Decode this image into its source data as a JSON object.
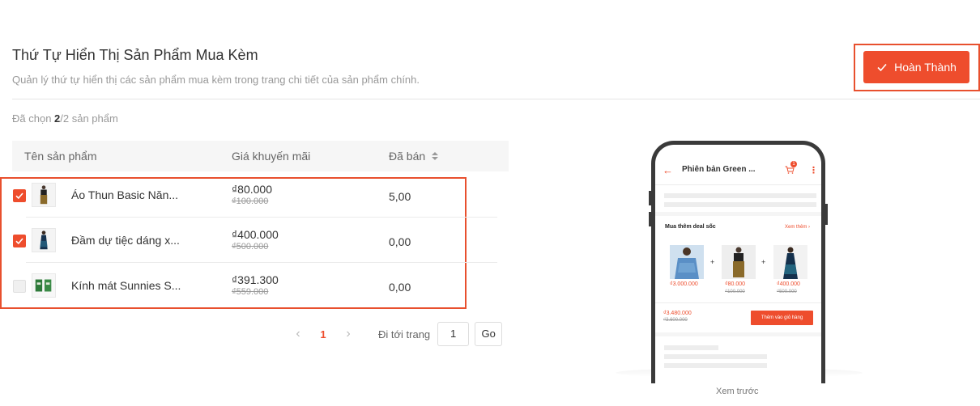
{
  "header": {
    "title": "Thứ Tự Hiển Thị Sản Phẩm Mua Kèm",
    "subtitle": "Quản lý thứ tự hiển thị các sản phẩm mua kèm trong trang chi tiết của sản phẩm chính.",
    "done_label": "Hoàn Thành"
  },
  "selection": {
    "prefix": "Đã chọn ",
    "selected": "2",
    "suffix": "/2 sản phẩm"
  },
  "table": {
    "columns": {
      "name": "Tên sản phẩm",
      "price": "Giá khuyến mãi",
      "sold": "Đã bán"
    },
    "rows": [
      {
        "checked": true,
        "name": "Áo Thun Basic Năn...",
        "price": "₫80.000",
        "original_price": "₫100.000",
        "sold": "5,00",
        "thumb": "pants-model"
      },
      {
        "checked": true,
        "name": "Đầm dự tiệc dáng x...",
        "price": "₫400.000",
        "original_price": "₫500.000",
        "sold": "0,00",
        "thumb": "dress-model"
      },
      {
        "checked": false,
        "name": "Kính mát Sunnies S...",
        "price": "₫391.300",
        "original_price": "₫559.000",
        "sold": "0,00",
        "thumb": "sunglasses-box"
      }
    ]
  },
  "pagination": {
    "current": "1",
    "goto_label": "Đi tới trang",
    "goto_value": "1",
    "go_label": "Go"
  },
  "preview": {
    "label": "Xem trước",
    "title": "Phiên bản Green ...",
    "cart_count": "1",
    "deal_title": "Mua thêm deal sốc",
    "see_more": "Xem thêm",
    "products": [
      {
        "price": "₫3.000.000",
        "original": ""
      },
      {
        "price": "₫80.000",
        "original": "₫100.000"
      },
      {
        "price": "₫400.000",
        "original": "₫500.000"
      }
    ],
    "total": "₫3.480.000",
    "total_original": "₫3.600.000",
    "add_to_cart": "Thêm vào giỏ hàng"
  },
  "colors": {
    "accent": "#ee4d2d",
    "highlight_border": "#e8502e"
  }
}
